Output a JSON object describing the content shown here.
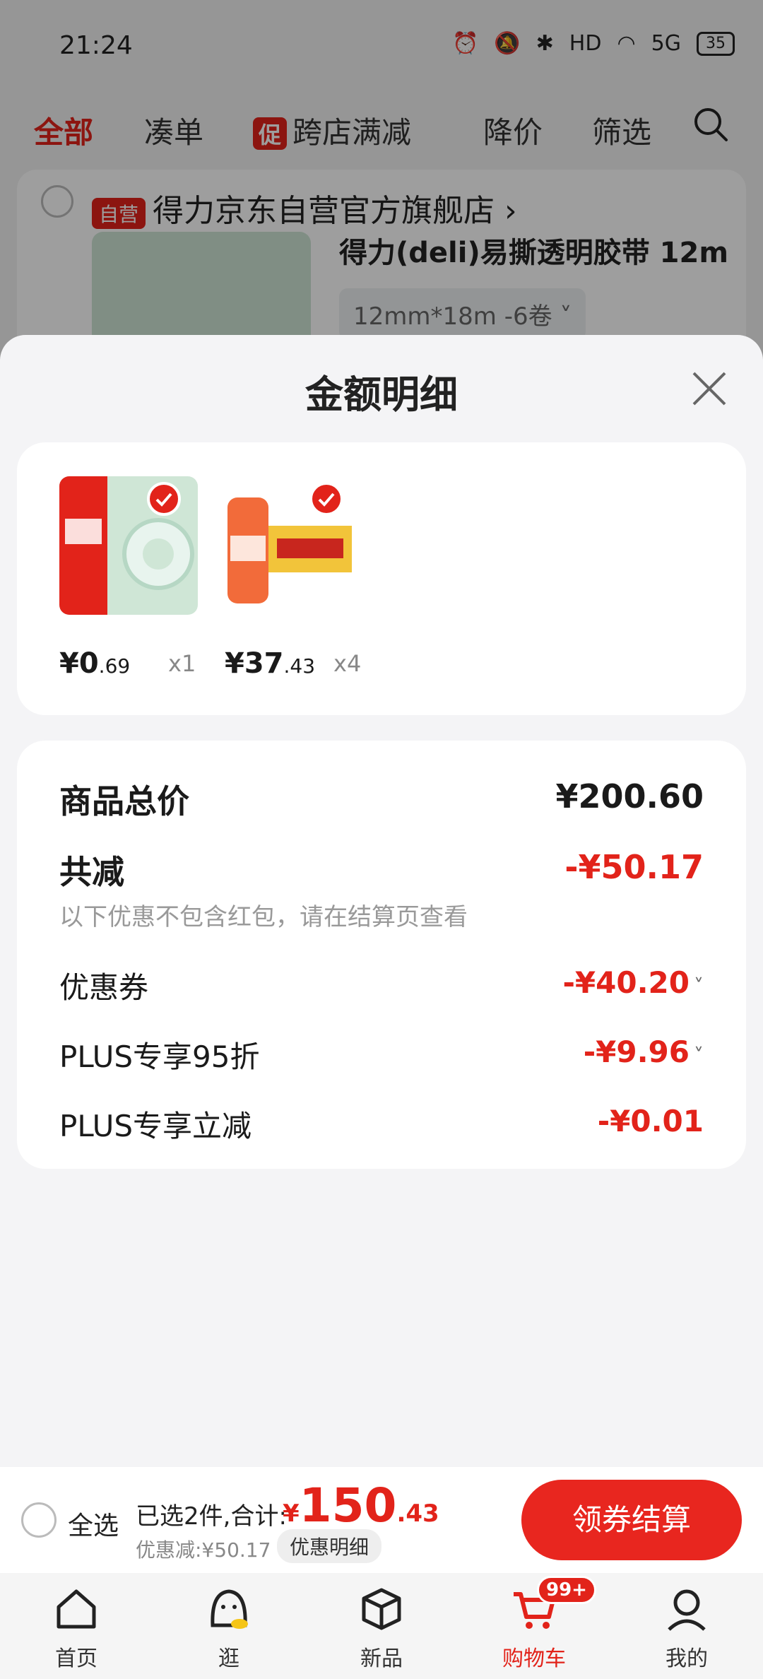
{
  "status_bar": {
    "time": "21:24",
    "battery": "35",
    "network": "5G",
    "hd": "HD"
  },
  "tabs": [
    {
      "label": "全部",
      "active": true
    },
    {
      "label": "凑单",
      "active": false
    },
    {
      "label": "跨店满减",
      "badge": "促",
      "active": false
    },
    {
      "label": "降价",
      "active": false
    },
    {
      "label": "筛选",
      "active": false
    }
  ],
  "store": {
    "badge": "自营",
    "name": "得力京东自营官方旗舰店",
    "product_title": "得力(deli)易撕透明胶带 12m",
    "spec": "12mm*18m -6卷"
  },
  "sheet": {
    "title": "金额明细",
    "items": [
      {
        "price_int": "¥0",
        "price_dec": ".69",
        "qty": "x1"
      },
      {
        "price_int": "¥37",
        "price_dec": ".43",
        "qty": "x4"
      }
    ],
    "summary": {
      "total_label": "商品总价",
      "total_value": "¥200.60",
      "reduce_label": "共减",
      "reduce_value": "-¥50.17",
      "note": "以下优惠不包含红包，请在结算页查看",
      "rows": [
        {
          "label": "优惠券",
          "value": "-¥40.20",
          "chevron": true
        },
        {
          "label": "PLUS专享95折",
          "value": "-¥9.96",
          "chevron": true
        },
        {
          "label": "PLUS专享立减",
          "value": "-¥0.01",
          "chevron": false
        }
      ]
    }
  },
  "checkout": {
    "select_all": "全选",
    "selected": "已选2件,合计:",
    "currency": "¥",
    "total_int": "150",
    "total_dec": ".43",
    "discount": "优惠减:¥50.17",
    "detail_button": "优惠明细",
    "checkout_button": "领券结算"
  },
  "nav": {
    "items": [
      "首页",
      "逛",
      "新品",
      "购物车",
      "我的"
    ],
    "active_index": 3,
    "cart_badge": "99+"
  },
  "colors": {
    "accent": "#e2231a"
  }
}
